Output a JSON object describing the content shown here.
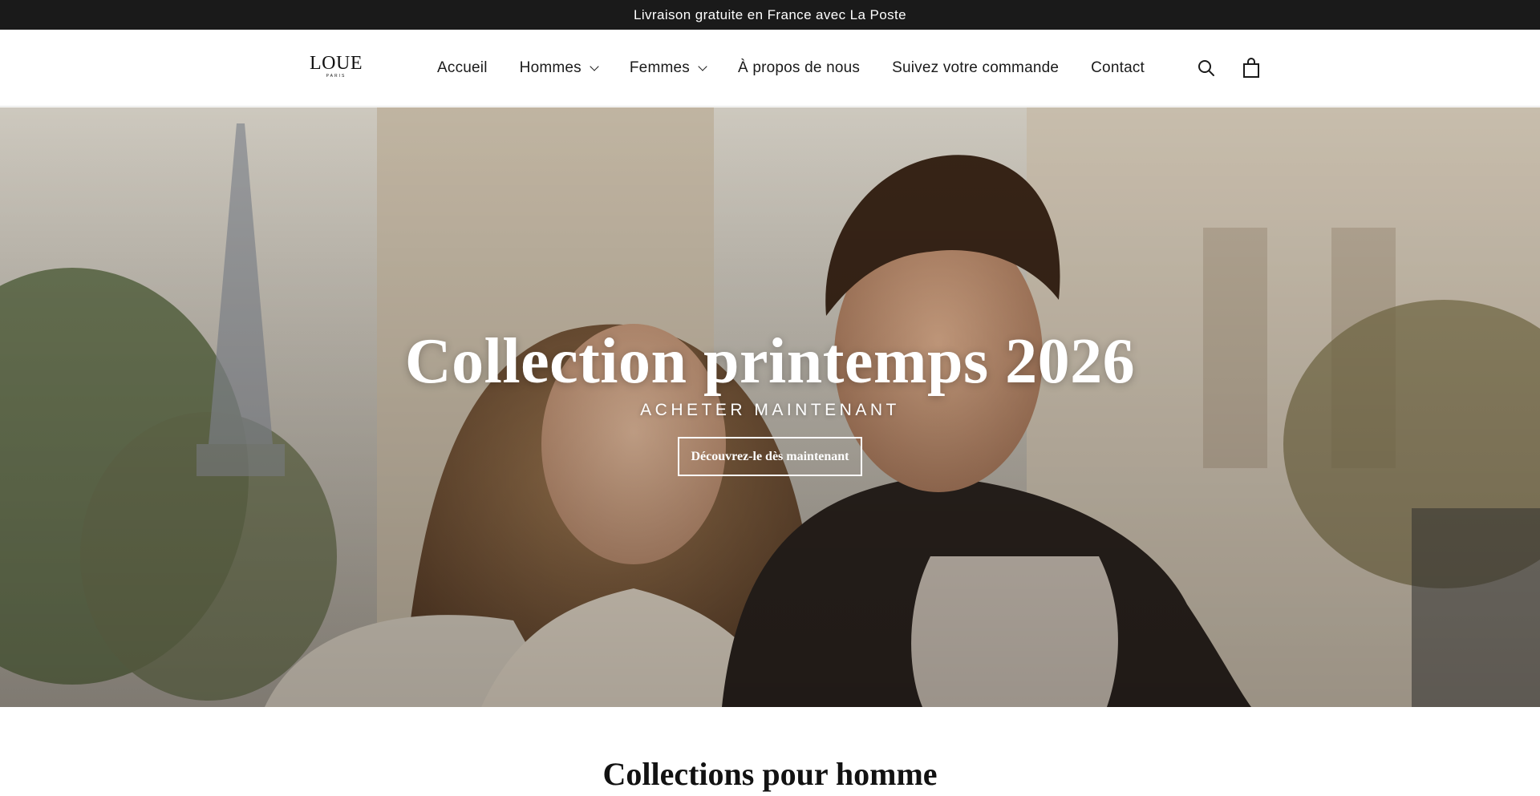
{
  "announcement": {
    "text": "Livraison gratuite en France avec La Poste"
  },
  "logo": {
    "main": "LOUE",
    "sub": "PARIS"
  },
  "nav": {
    "items": [
      {
        "label": "Accueil",
        "dropdown": false
      },
      {
        "label": "Hommes",
        "dropdown": true
      },
      {
        "label": "Femmes",
        "dropdown": true
      },
      {
        "label": "À propos de nous",
        "dropdown": false
      },
      {
        "label": "Suivez votre commande",
        "dropdown": false
      },
      {
        "label": "Contact",
        "dropdown": false
      }
    ]
  },
  "header_icons": [
    "search-icon",
    "cart-icon"
  ],
  "hero": {
    "title": "Collection printemps 2026",
    "subtitle": "ACHETER MAINTENANT",
    "button": "Découvrez-le dès maintenant"
  },
  "section": {
    "title": "Collections pour homme"
  },
  "colors": {
    "announcement_bg": "#1a1a1a",
    "text": "#121212",
    "hero_text": "#ffffff"
  }
}
